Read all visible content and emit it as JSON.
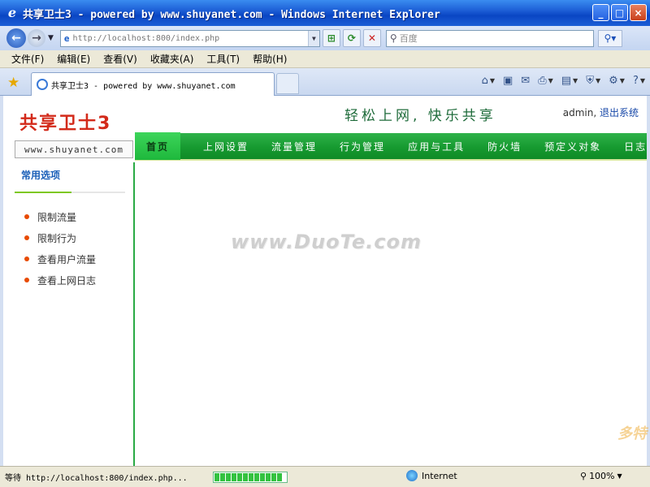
{
  "window": {
    "title": "共享卫士3 - powered by www.shuyanet.com - Windows Internet Explorer",
    "buttons": {
      "minimize": "_",
      "maximize": "□",
      "close": "×"
    }
  },
  "browser": {
    "address": "http://localhost:800/index.php",
    "search_placeholder": "百度",
    "menu": [
      "文件(F)",
      "编辑(E)",
      "查看(V)",
      "收藏夹(A)",
      "工具(T)",
      "帮助(H)"
    ],
    "tab_title": "共享卫士3 - powered by www.shuyanet.com",
    "status_text": "等待 http://localhost:800/index.php...",
    "progress": 1.0,
    "zone": "Internet",
    "zoom": "100%"
  },
  "page": {
    "brand": "共享卫士3",
    "domain": "www.shuyanet.com",
    "slogan": "轻松上网, 快乐共享",
    "user": "admin,",
    "logout": "退出系统",
    "nav": [
      "首页",
      "上网设置",
      "流量管理",
      "行为管理",
      "应用与工具",
      "防火墙",
      "预定义对象",
      "日志"
    ],
    "sidebar": {
      "heading": "常用选项",
      "items": [
        "限制流量",
        "限制行为",
        "查看用户流量",
        "查看上网日志"
      ]
    },
    "watermark": "www.DuoTe.com",
    "corner_seal": "多特"
  },
  "icons": {
    "back": "back-arrow-icon",
    "forward": "forward-arrow-icon",
    "stop": "stop-icon",
    "refresh": "refresh-icon",
    "search": "search-icon",
    "home": "home-icon",
    "favorites": "star-icon"
  }
}
